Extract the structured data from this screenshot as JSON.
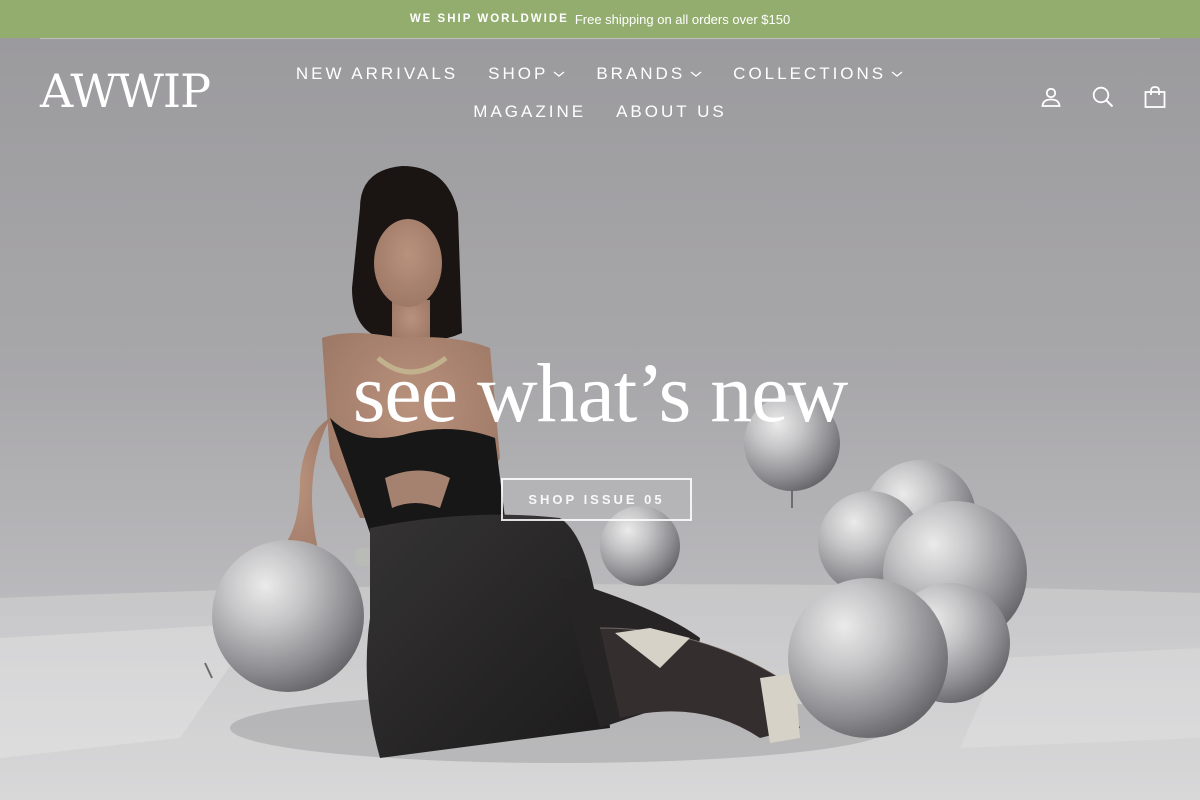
{
  "announcement": {
    "highlight": "WE SHIP WORLDWIDE",
    "text": "Free shipping on all orders over $150",
    "background": "#93ad6e"
  },
  "header": {
    "logo": "AWWIP",
    "nav": [
      {
        "label": "NEW ARRIVALS",
        "dropdown": false
      },
      {
        "label": "SHOP",
        "dropdown": true
      },
      {
        "label": "BRANDS",
        "dropdown": true
      },
      {
        "label": "COLLECTIONS",
        "dropdown": true
      },
      {
        "label": "MAGAZINE",
        "dropdown": false
      },
      {
        "label": "ABOUT US",
        "dropdown": false
      }
    ],
    "icons": {
      "account": {
        "icon": "user-icon",
        "label": "Log in"
      },
      "search": {
        "icon": "search-icon",
        "label": "Search"
      },
      "cart": {
        "icon": "bag-icon",
        "label": "Cart"
      }
    }
  },
  "hero": {
    "title": "see what’s new",
    "button": "SHOP ISSUE 05",
    "image": "model in black dress seated on floor with silver balloons"
  }
}
